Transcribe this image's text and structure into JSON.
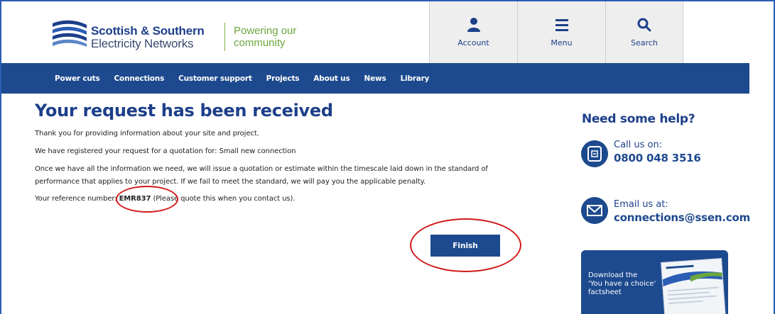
{
  "header": {
    "brand_line1": "Scottish & Southern",
    "brand_line2": "Electricity Networks",
    "tagline_line1": "Powering our",
    "tagline_line2": "community",
    "buttons": [
      {
        "label": "Account",
        "icon": "user-icon"
      },
      {
        "label": "Menu",
        "icon": "menu-icon"
      },
      {
        "label": "Search",
        "icon": "search-icon"
      }
    ]
  },
  "nav": {
    "items": [
      "Power cuts",
      "Connections",
      "Customer support",
      "Projects",
      "About us",
      "News",
      "Library"
    ]
  },
  "main": {
    "title": "Your request has been received",
    "p1": "Thank you for providing information about your site and project.",
    "p2": "We have registered your request for a quotation for: Small new connection",
    "p3a": "Once we have all the information we need, we will issue a quotation or estimate within the timescale laid down in the standard of",
    "p3b": "performance that applies to your project. If we fail to meet the standard, we will pay you the applicable penalty.",
    "ref_prefix": "Your reference number:",
    "ref_number": "EMR837",
    "ref_suffix": "(Please quote this when you contact us).",
    "finish_label": "Finish"
  },
  "sidebar": {
    "title": "Need some help?",
    "call_label": "Call us on:",
    "call_value": "0800 048 3516",
    "email_label": "Email us at:",
    "email_value": "connections@ssen.com",
    "promo_line1": "Download the",
    "promo_line2": "'You have a choice'",
    "promo_line3": "factsheet"
  },
  "colors": {
    "brand_blue": "#1d4a8e",
    "brand_green": "#6ba73d",
    "annotation_red": "#d21a1a"
  }
}
